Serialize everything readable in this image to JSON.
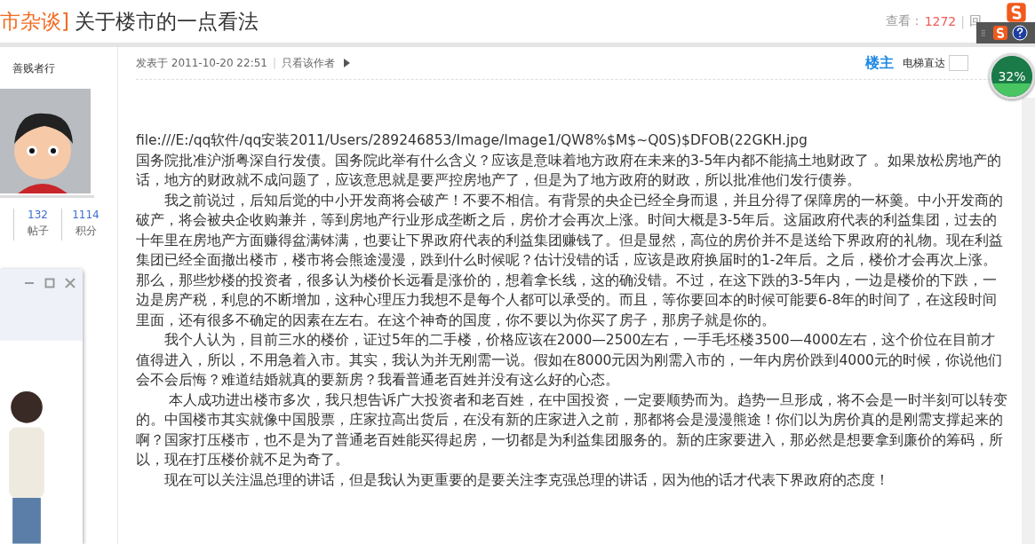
{
  "thread": {
    "category": "市杂谈]",
    "title": "关于楼市的一点看法",
    "views_label": "查看：",
    "views": "1272",
    "separator": "|",
    "replies_label": "回"
  },
  "author": {
    "name": "善贱者行",
    "stats": [
      {
        "value": "132",
        "label": "帖子"
      },
      {
        "value": "1114",
        "label": "积分"
      }
    ]
  },
  "post": {
    "posted": "发表于 2011-10-20 22:51",
    "separator": "|",
    "only_author": "只看该作者",
    "floor": "楼主",
    "jump_label": "电梯直达",
    "paragraphs": [
      "file:///E:/qq软件/qq安装2011/Users/289246853/Image/Image1/QW8%$M$~Q0S)$DFOB(22GKH.jpg",
      "国务院批准沪浙粤深自行发债。国务院此举有什么含义？应该是意味着地方政府在未来的3-5年内都不能搞土地财政了 。如果放松房地产的话，地方的财政就不成问题了，应该意思就是要严控房地产了，但是为了地方政府的财政，所以批准他们发行债券。",
      "　　我之前说过，后知后觉的中小开发商将会破产！不要不相信。有背景的央企已经全身而退，并且分得了保障房的一杯羹。中小开发商的破产，将会被央企收购兼并，等到房地产行业形成垄断之后，房价才会再次上涨。时间大概是3-5年后。这届政府代表的利益集团，过去的十年里在房地产方面赚得盆满钵满，也要让下界政府代表的利益集团赚钱了。但是显然，高位的房价并不是送给下界政府的礼物。现在利益集团已经全面撤出楼市，楼市将会熊途漫漫，跌到什么时候呢？估计没错的话，应该是政府换届时的1-2年后。之后，楼价才会再次上涨。那么，那些炒楼的投资者，很多认为楼价长远看是涨价的，想着拿长线，这的确没错。不过，在这下跌的3-5年内，一边是楼价的下跌，一边是房产税，利息的不断增加，这种心理压力我想不是每个人都可以承受的。而且，等你要回本的时候可能要6-8年的时间了，在这段时间里面，还有很多不确定的因素在左右。在这个神奇的国度，你不要以为你买了房子，那房子就是你的。",
      "　　我个人认为，目前三水的楼价，证过5年的二手楼，价格应该在2000—2500左右，一手毛坯楼3500—4000左右，这个价位在目前才值得进入，所以，不用急着入市。其实，我认为并无刚需一说。假如在8000元因为刚需入市的，一年内房价跌到4000元的时候，你说他们会不会后悔？难道结婚就真的要新房？我看普通老百姓并没有这么好的心态。",
      "　　 本人成功进出楼市多次，我只想告诉广大投资者和老百姓，在中国投资，一定要顺势而为。趋势一旦形成，将不会是一时半刻可以转变的。中国楼市其实就像中国股票，庄家拉高出货后，在没有新的庄家进入之前，那都将会是漫漫熊途！你们以为房价真的是刚需支撑起来的啊？国家打压楼市，也不是为了普通老百姓能买得起房，一切都是为利益集团服务的。新的庄家要进入，那必然是想要拿到廉价的筹码，所以，现在打压楼价就不足为奇了。",
      "　　现在可以关注温总理的讲话，但是我认为更重要的是要关注李克强总理的讲话，因为他的话才代表下界政府的态度！"
    ]
  },
  "progress": {
    "reading": "32%"
  }
}
